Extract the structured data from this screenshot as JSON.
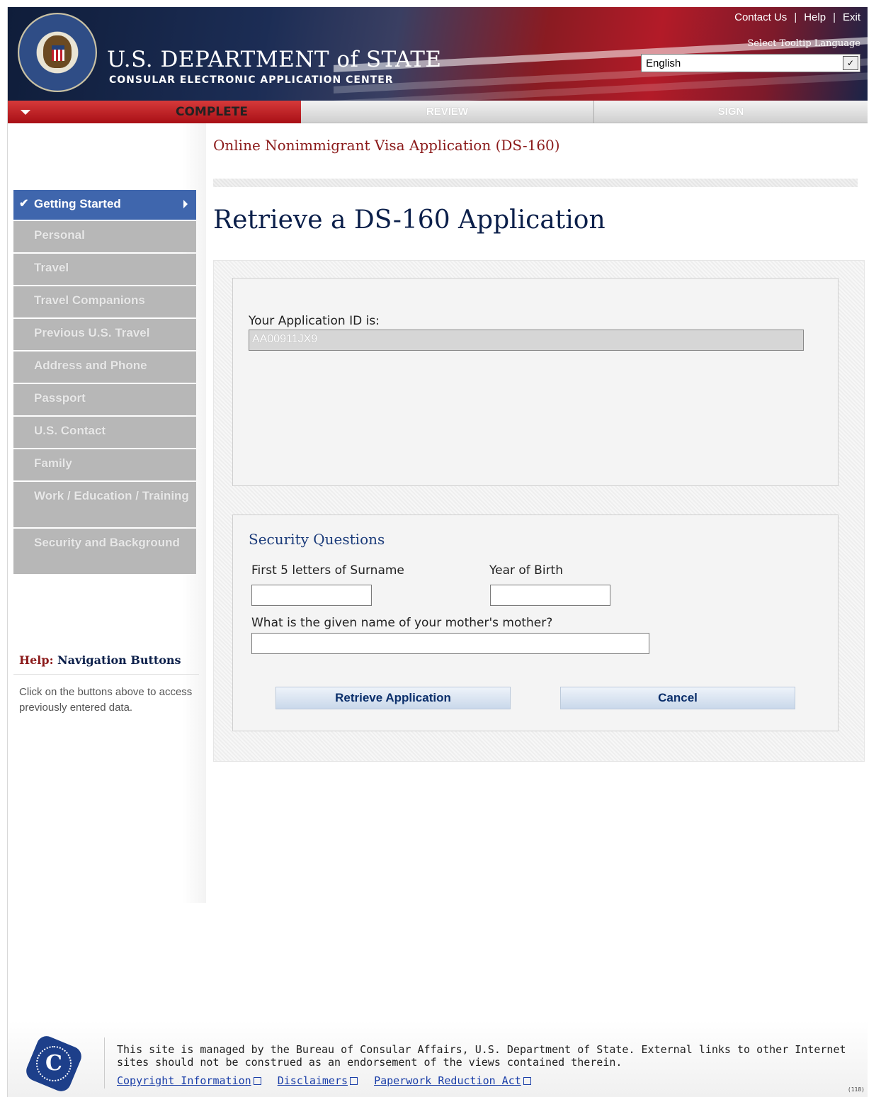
{
  "header": {
    "title": "U.S. DEPARTMENT of STATE",
    "subtitle": "CONSULAR ELECTRONIC APPLICATION CENTER",
    "links": [
      "Contact Us",
      "Help",
      "Exit"
    ],
    "tooltip_label": "Select Tooltip Language",
    "language_value": "English"
  },
  "progress": {
    "steps": [
      "COMPLETE",
      "REVIEW",
      "SIGN"
    ],
    "active": "COMPLETE"
  },
  "page": {
    "heading": "Online Nonimmigrant Visa Application (DS-160)",
    "title": "Retrieve a DS-160 Application"
  },
  "sidebar": {
    "items": [
      "Getting Started",
      "Personal",
      "Travel",
      "Travel Companions",
      "Previous U.S. Travel",
      "Address and Phone",
      "Passport",
      "U.S. Contact",
      "Family",
      "Work / Education / Training",
      "Security and Background"
    ]
  },
  "help": {
    "prefix": "Help:",
    "title": "Navigation Buttons",
    "text": "Click on the buttons above to access previously entered data."
  },
  "application": {
    "id_label": "Your Application ID is:",
    "id_value": "AA00911JX9"
  },
  "security": {
    "title": "Security Questions",
    "surname_label": "First 5 letters of Surname",
    "year_label": "Year of Birth",
    "mother_label": "What is the given name of your mother's mother?",
    "retrieve_label": "Retrieve Application",
    "cancel_label": "Cancel"
  },
  "footer": {
    "text": "This site is managed by the Bureau of Consular Affairs, U.S. Department of State. External links to other Internet sites should not be construed as an endorsement of the views contained therein.",
    "links": [
      "Copyright Information",
      "Disclaimers",
      "Paperwork Reduction Act"
    ],
    "counter": "(118)"
  }
}
